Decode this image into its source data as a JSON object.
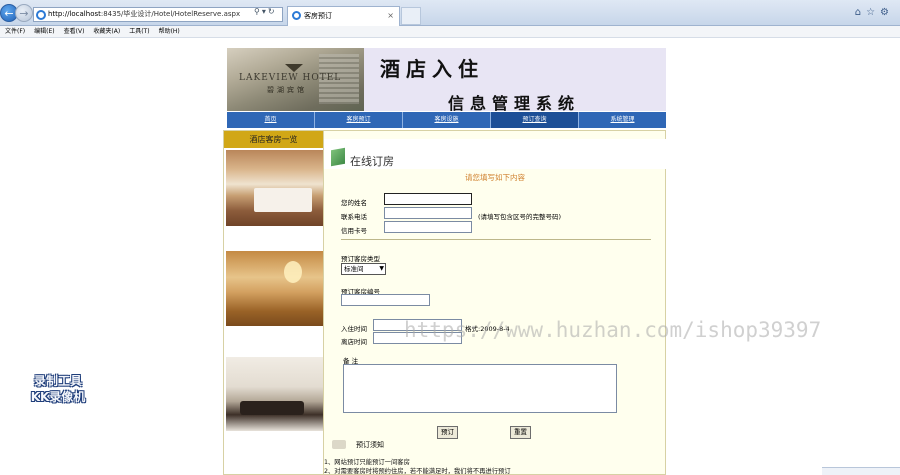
{
  "browser": {
    "address": "http://localhost:8435/毕业设计/Hotel/HotelReserve.aspx",
    "address_host": "http://localhost",
    "address_rest": ":8435/毕业设计/Hotel/HotelReserve.aspx",
    "tab_title": "客房预订",
    "menu": [
      "文件(F)",
      "编辑(E)",
      "查看(V)",
      "收藏夹(A)",
      "工具(T)",
      "帮助(H)"
    ]
  },
  "banner": {
    "logo_en": "LAKEVIEW HOTEL",
    "logo_cn": "碧湖宾馆",
    "title_line1": "酒店入住",
    "title_line2": "信息管理系统"
  },
  "nav": [
    "首页",
    "客房预订",
    "客房设施",
    "预订查询",
    "系统管理"
  ],
  "sidebar": {
    "title": "酒店客房一览"
  },
  "content": {
    "title": "在线订房",
    "hint": "请您填写如下内容",
    "name_label": "您的姓名",
    "phone_label": "联系电话",
    "phone_note": "(请填写包含区号的完整号码)",
    "card_label": "信用卡号",
    "room_type_label": "预订客房类型",
    "room_type_value": "标准间",
    "room_number_label": "预订客房编号",
    "checkin_label": "入住时间",
    "checkin_note": "格式:2009-8-4",
    "checkout_label": "离店时间",
    "remark_label": "备 注",
    "submit_label": "预订",
    "reset_label": "重置",
    "rules_title": "预订须知",
    "rules": [
      "1、网站预订只能预订一间客房",
      "2、对需要客房时将预约住房，若不能满足时，我们将不再进行预订"
    ]
  },
  "overlay": {
    "watermark": "https://www.huzhan.com/ishop39397",
    "recorder_line1": "录制工具",
    "recorder_line2": "KK录像机"
  }
}
